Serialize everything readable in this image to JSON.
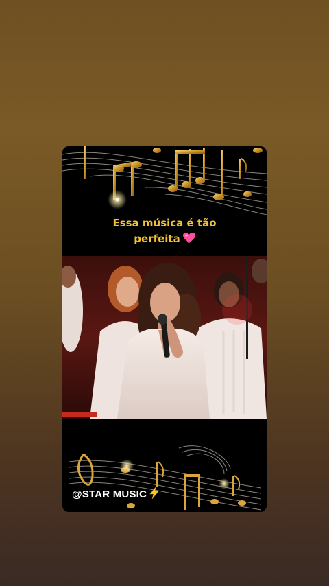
{
  "story": {
    "caption_line1": "Essa música é tão",
    "caption_line2": "perfeita",
    "caption_emoji_icon": "pink-heart-icon",
    "watermark": "@STAR MUSIC",
    "watermark_emoji_icon": "lightning-bolt-icon",
    "video_content": "singer-performance"
  },
  "colors": {
    "background_top": "#7a5a26",
    "background_bottom": "#3a2a24",
    "card": "#000000",
    "caption": "#f2c232",
    "notes_gold": "#d8a63a",
    "heart": "#ff4f9a"
  }
}
